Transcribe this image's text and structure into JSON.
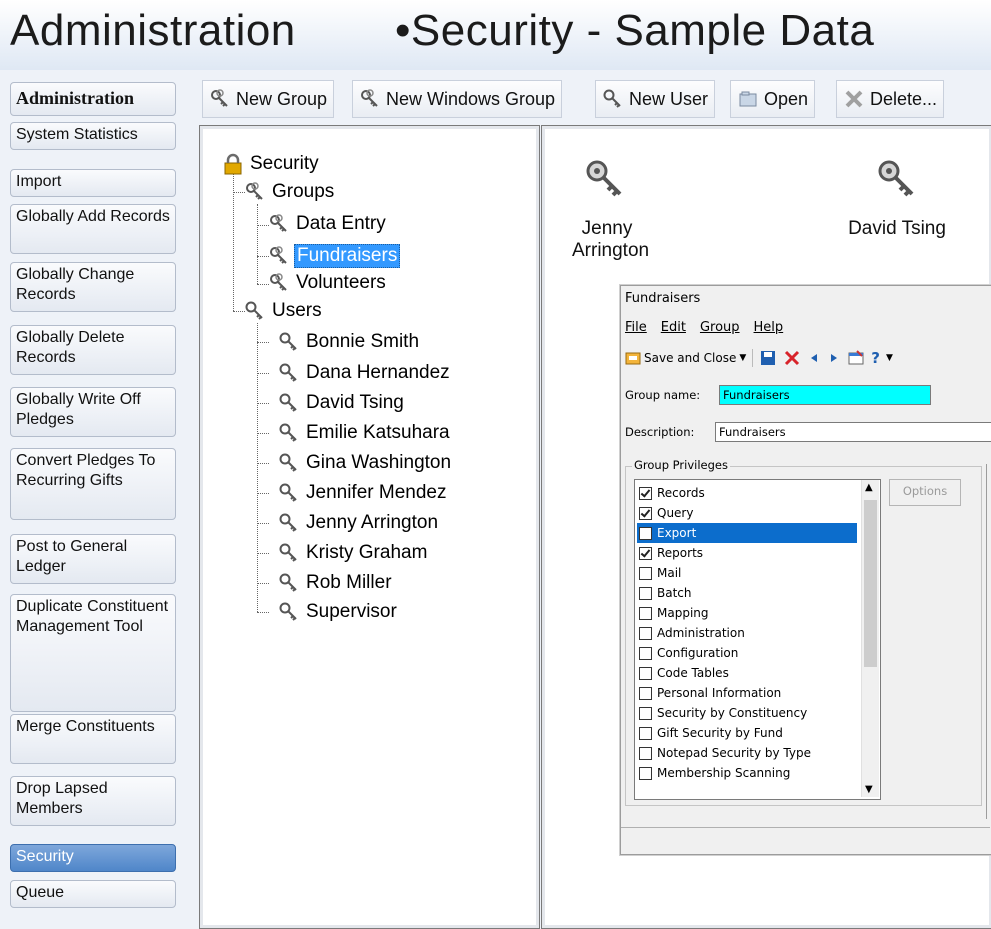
{
  "title": {
    "left": "Administration",
    "right": "•Security - Sample Data"
  },
  "nav": {
    "items": [
      {
        "label": "Administration"
      },
      {
        "label": "System Statistics"
      },
      {
        "label": "Import"
      },
      {
        "label": "Globally Add Records"
      },
      {
        "label": "Globally Change Records"
      },
      {
        "label": "Globally Delete Records"
      },
      {
        "label": "Globally Write Off Pledges"
      },
      {
        "label": "Convert Pledges To Recurring Gifts"
      },
      {
        "label": "Post to General Ledger"
      },
      {
        "label": "Duplicate Constituent Management Tool"
      },
      {
        "label": "Merge Constituents"
      },
      {
        "label": "Drop Lapsed Members"
      },
      {
        "label": "Security"
      },
      {
        "label": "Queue"
      }
    ],
    "active": "Security"
  },
  "toolbar": {
    "new_group": "New Group",
    "new_windows_group": "New Windows Group",
    "new_user": "New User",
    "open": "Open",
    "delete": "Delete..."
  },
  "tree": {
    "root": "Security",
    "groups_label": "Groups",
    "groups": [
      "Data Entry",
      "Fundraisers",
      "Volunteers"
    ],
    "selected_group": "Fundraisers",
    "users_label": "Users",
    "users": [
      "Bonnie Smith",
      "Dana Hernandez",
      "David Tsing",
      "Emilie Katsuhara",
      "Gina Washington",
      "Jennifer Mendez",
      "Jenny Arrington",
      "Kristy Graham",
      "Rob Miller",
      "Supervisor"
    ]
  },
  "icon_view": {
    "users": [
      {
        "line1": "Jenny",
        "line2": "Arrington"
      },
      {
        "line1": "David Tsing",
        "line2": ""
      }
    ]
  },
  "dialog": {
    "title": "Fundraisers",
    "menu": [
      "File",
      "Edit",
      "Group",
      "Help"
    ],
    "save_close": "Save and Close",
    "group_name_label": "Group name:",
    "group_name_value": "Fundraisers",
    "description_label": "Description:",
    "description_value": "Fundraisers",
    "privileges_legend": "Group Privileges",
    "options_button": "Options",
    "privileges": [
      {
        "label": "Records",
        "checked": true
      },
      {
        "label": "Query",
        "checked": true
      },
      {
        "label": "Export",
        "checked": false,
        "selected": true
      },
      {
        "label": "Reports",
        "checked": true
      },
      {
        "label": "Mail",
        "checked": false
      },
      {
        "label": "Batch",
        "checked": false
      },
      {
        "label": "Mapping",
        "checked": false
      },
      {
        "label": "Administration",
        "checked": false
      },
      {
        "label": "Configuration",
        "checked": false
      },
      {
        "label": "Code Tables",
        "checked": false
      },
      {
        "label": "Personal Information",
        "checked": false
      },
      {
        "label": "Security by Constituency",
        "checked": false
      },
      {
        "label": "Gift Security by Fund",
        "checked": false
      },
      {
        "label": "Notepad Security by Type",
        "checked": false
      },
      {
        "label": "Membership Scanning",
        "checked": false
      }
    ]
  },
  "colors": {
    "accent": "#4f86c9",
    "selection": "#3399ff",
    "group_name_bg": "#00ffff"
  }
}
